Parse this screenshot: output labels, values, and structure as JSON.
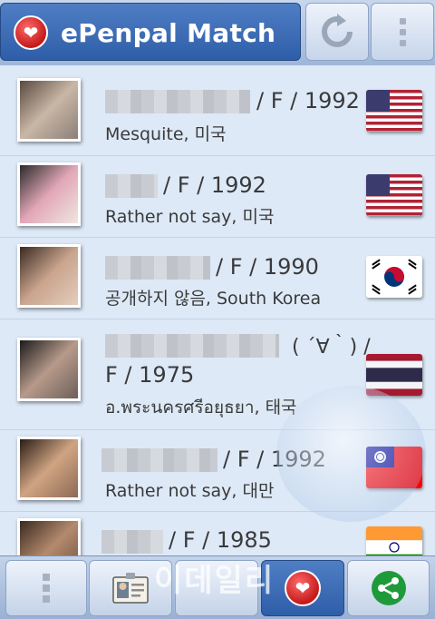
{
  "app": {
    "title": "ePenpal Match",
    "logo_icon": "heart-icon",
    "refresh_icon": "refresh-icon",
    "menu_icon": "overflow-menu-icon"
  },
  "users": [
    {
      "info": "/ F / 1992",
      "location": "Mesquite, 미국",
      "flag": "us"
    },
    {
      "info": "/ F / 1992",
      "location": "Rather not say, 미국",
      "flag": "us"
    },
    {
      "info": "/ F / 1990",
      "location": "공개하지 않음, South Korea",
      "flag": "kr"
    },
    {
      "info_line1": "( ´∀｀) /",
      "info_line2": "F / 1975",
      "location": "อ.พระนครศรีอยุธยา, 태국",
      "flag": "th"
    },
    {
      "info": "/ F / 1992",
      "location": "Rather not say, 대만",
      "flag": "tw"
    },
    {
      "info": "/ F / 1985",
      "location": "",
      "flag": "in"
    }
  ],
  "bottom_nav": [
    {
      "icon": "overflow-menu-icon"
    },
    {
      "icon": "profile-card-icon"
    },
    {
      "icon": "menu-icon"
    },
    {
      "icon": "heart-icon",
      "active": true
    },
    {
      "icon": "share-icon"
    }
  ],
  "watermark": "이데일리",
  "colors": {
    "accent": "#2f5ea9",
    "heart": "#c41a1a",
    "share": "#1f9a3a"
  }
}
